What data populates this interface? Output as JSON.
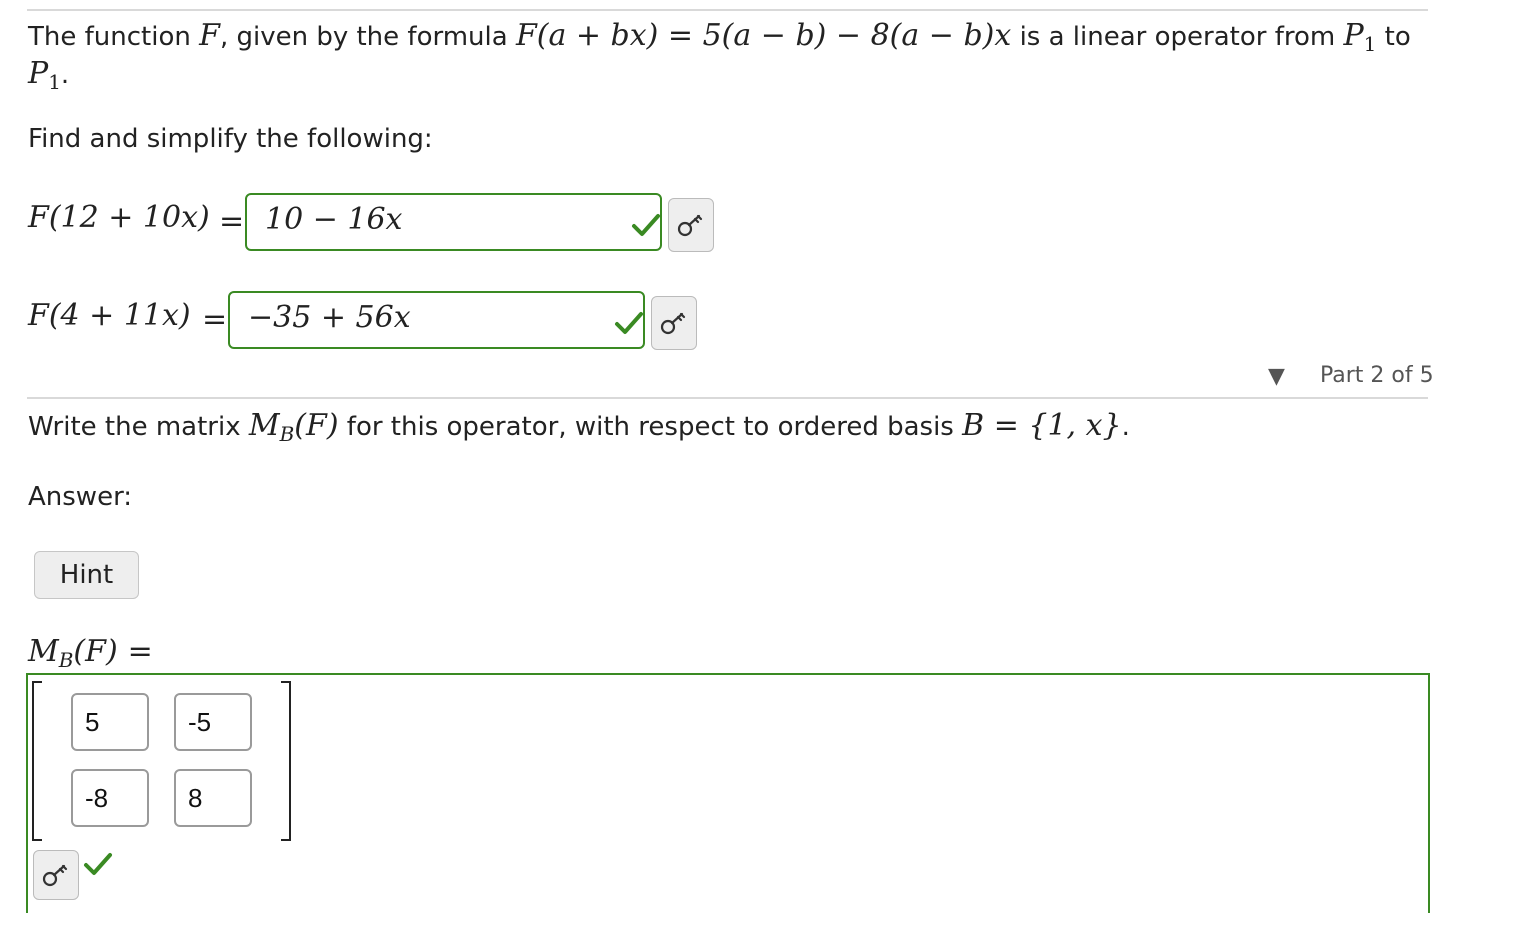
{
  "intro": {
    "p1": "The function ",
    "F": "F",
    "p2": ", given by the formula ",
    "formula": "F(a + bx) = 5(a − b) − 8(a − b)x",
    "p3": " is a linear operator from ",
    "P": "P",
    "sub": "1",
    "p4": " to",
    "period": "."
  },
  "prompt": "Find and simplify the following:",
  "questions": [
    {
      "lhs": "F(12 + 10x)",
      "eq": "=",
      "answer": "10 − 16x",
      "correct": true
    },
    {
      "lhs": "F(4 + 11x)",
      "eq": "=",
      "answer": "−35 + 56x",
      "correct": true
    }
  ],
  "part": {
    "arrow": "▼",
    "label": "Part 2 of 5"
  },
  "matrix_question": {
    "p1": "Write the matrix ",
    "M": "M",
    "Msub": "B",
    "arg": "(F)",
    "p2": " for this operator, with respect to ordered basis ",
    "basis": "B = {1, x}",
    "period": "."
  },
  "answer_label": "Answer:",
  "hint_label": "Hint",
  "matrix_lhs": {
    "M": "M",
    "sub": "B",
    "arg": "(F)",
    "eq": "="
  },
  "matrix": {
    "rows": [
      [
        "5",
        "-5"
      ],
      [
        "-8",
        "8"
      ]
    ],
    "correct": true
  },
  "colors": {
    "correct_green": "#3a8a23",
    "rule_gray": "#d9d9d9"
  },
  "icons": [
    "key-icon",
    "check-icon"
  ]
}
